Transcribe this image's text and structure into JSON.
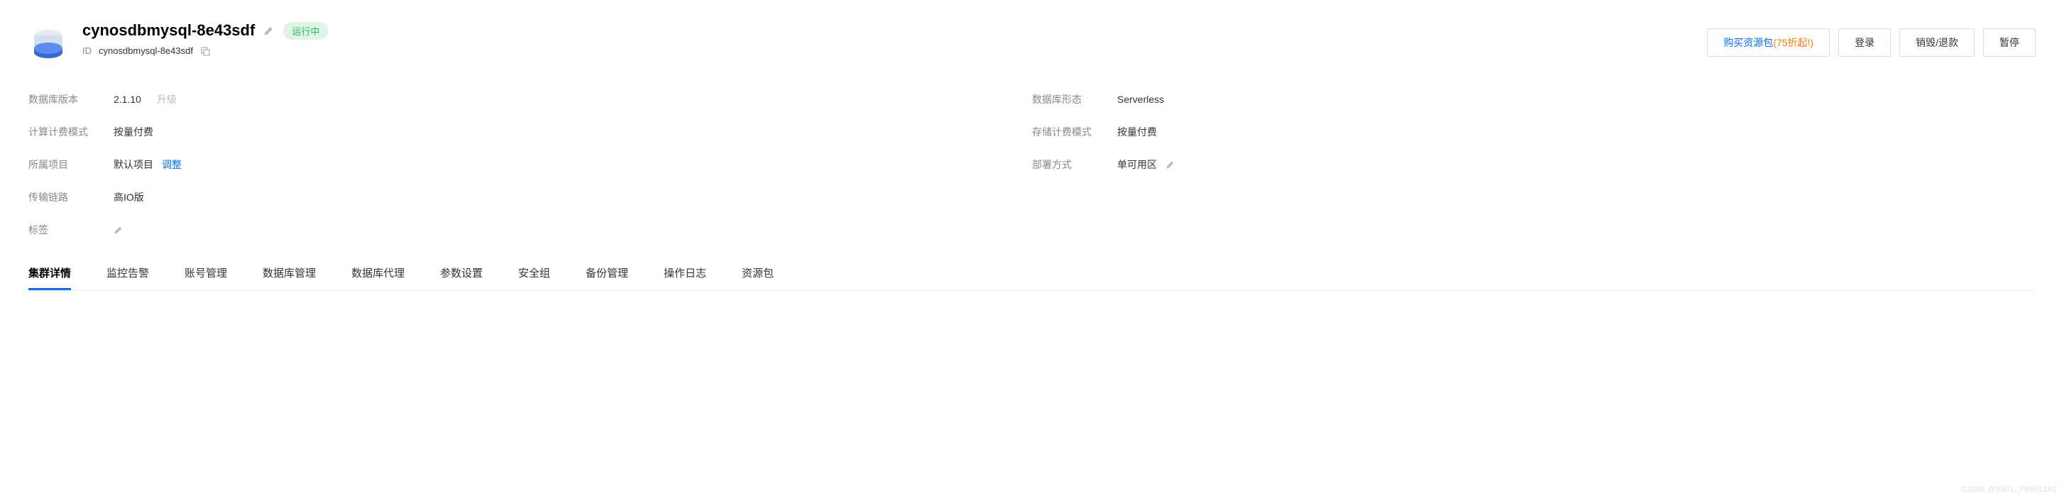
{
  "header": {
    "title": "cynosdbmysql-8e43sdf",
    "status": "运行中",
    "id_label": "ID",
    "id_value": "cynosdbmysql-8e43sdf"
  },
  "actions": {
    "buy_package_prefix": "购买资源包",
    "buy_package_highlight": "(75折起!)",
    "login": "登录",
    "destroy_refund": "销毁/退款",
    "pause": "暂停"
  },
  "info": {
    "db_version_label": "数据库版本",
    "db_version_value": "2.1.10",
    "upgrade_text": "升级",
    "db_form_label": "数据库形态",
    "db_form_value": "Serverless",
    "compute_billing_label": "计算计费模式",
    "compute_billing_value": "按量付费",
    "storage_billing_label": "存储计费模式",
    "storage_billing_value": "按量付费",
    "project_label": "所属项目",
    "project_value": "默认项目",
    "project_adjust": "调整",
    "deploy_label": "部署方式",
    "deploy_value": "单可用区",
    "transport_label": "传输链路",
    "transport_value": "高IO版",
    "tag_label": "标签"
  },
  "tabs": [
    "集群详情",
    "监控告警",
    "账号管理",
    "数据库管理",
    "数据库代理",
    "参数设置",
    "安全组",
    "备份管理",
    "操作日志",
    "资源包"
  ],
  "watermark": "CSDN @2301_79651252"
}
